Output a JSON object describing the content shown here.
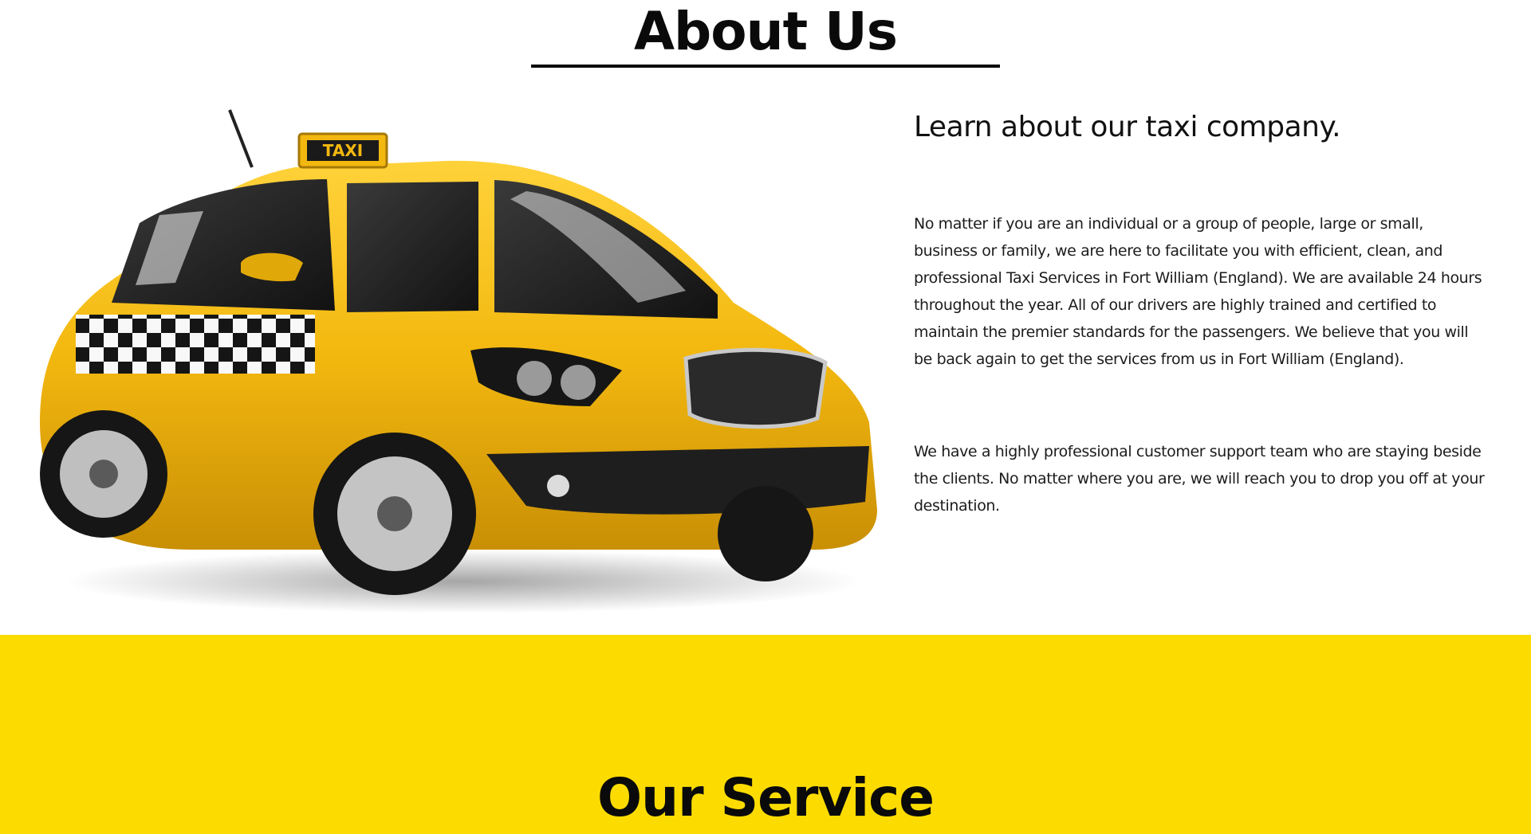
{
  "about": {
    "title": "About Us",
    "taxi_sign": "TAXI",
    "subheading": "Learn about our taxi company.",
    "paragraph_1": "No matter if you are an individual or a group of people, large or small, business or family, we are here to facilitate you with efficient, clean, and professional Taxi Services in Fort William (England). We are available 24 hours throughout the year. All of our drivers are highly trained and certified to maintain the premier standards for the passengers. We believe that you will be back again to get the services from us in Fort William (England).",
    "paragraph_2": "We have a highly professional customer support team who are staying beside the clients. No matter where you are, we will reach you to drop you off at your destination."
  },
  "service": {
    "title": "Our Service"
  },
  "colors": {
    "accent_yellow": "#fcdc00",
    "taxi_body": "#f3b80f",
    "text_dark": "#111111"
  }
}
